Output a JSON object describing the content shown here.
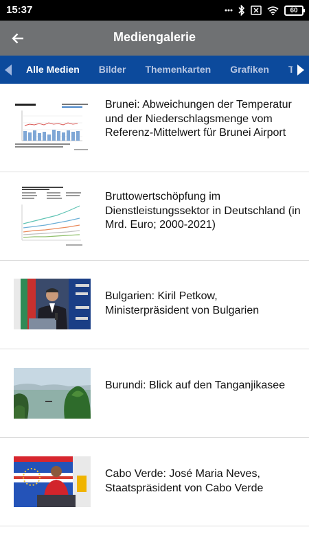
{
  "status_bar": {
    "time": "15:37",
    "battery": "60",
    "icons": [
      "dots-icon",
      "bluetooth-icon",
      "sim-off-icon",
      "wifi-icon",
      "battery-icon"
    ]
  },
  "app_bar": {
    "back_icon": "arrow-left-icon",
    "title": "Mediengalerie"
  },
  "tabs": {
    "items": [
      {
        "label": "Alle Medien",
        "active": true
      },
      {
        "label": "Bilder",
        "active": false
      },
      {
        "label": "Themenkarten",
        "active": false
      },
      {
        "label": "Grafiken",
        "active": false
      },
      {
        "label": "Tab",
        "active": false
      }
    ]
  },
  "media_items": [
    {
      "title": "Brunei: Abweichungen der Temperatur und der Niederschlagsmenge vom Referenz-Mittelwert für Brunei Airport",
      "thumb": "chart-thumbnail"
    },
    {
      "title": "Bruttowertschöpfung im Dienstleistungssektor in Deutschland (in Mrd. Euro; 2000-2021)",
      "thumb": "chart-thumbnail"
    },
    {
      "title": "Bulgarien: Kiril Petkow, Ministerpräsident von Bulgarien",
      "thumb": "photo-thumbnail"
    },
    {
      "title": "Burundi: Blick auf den Tanganjikasee",
      "thumb": "photo-thumbnail"
    },
    {
      "title": "Cabo Verde: José Maria Neves, Staatspräsident von Cabo Verde",
      "thumb": "photo-thumbnail"
    }
  ],
  "colors": {
    "status_bar": "#000000",
    "app_bar": "#6f7173",
    "tab_bar": "#0c4a9c",
    "tab_inactive": "#b7c6e2",
    "divider": "#dcdcdc"
  }
}
